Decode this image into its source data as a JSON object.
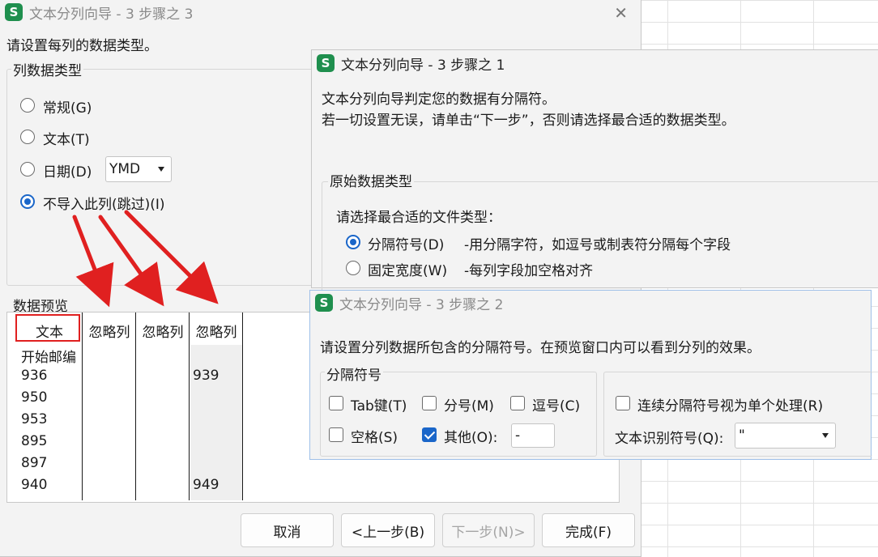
{
  "step3": {
    "title": "文本分列向导 - 3 步骤之 3",
    "instruction": "请设置每列的数据类型。",
    "group_label": "列数据类型",
    "radio_general": "常规(G)",
    "radio_text": "文本(T)",
    "radio_date": "日期(D)",
    "date_format": "YMD",
    "radio_skip": "不导入此列(跳过)(I)",
    "selected_type": "skip",
    "preview_label": "数据预览",
    "preview_headers": [
      "文本",
      "忽略列",
      "忽略列",
      "忽略列"
    ],
    "preview_col1": [
      "开始邮编",
      "936",
      "950",
      "953",
      "895",
      "897",
      "940"
    ],
    "preview_col4": [
      "939",
      "949"
    ],
    "cancel": "取消",
    "back": "<上一步(B)",
    "next": "下一步(N)>",
    "finish": "完成(F)"
  },
  "step1": {
    "title": "文本分列向导 - 3 步骤之 1",
    "line1": "文本分列向导判定您的数据有分隔符。",
    "line2": "若一切设置无误，请单击“下一步”，否则请选择最合适的数据类型。",
    "group_label": "原始数据类型",
    "prompt": "请选择最合适的文件类型：",
    "opt_delimited": "分隔符号(D)",
    "opt_delimited_desc": "-用分隔字符，如逗号或制表符分隔每个字段",
    "opt_fixed": "固定宽度(W)",
    "opt_fixed_desc": "-每列字段加空格对齐",
    "selected": "delimited"
  },
  "step2": {
    "title": "文本分列向导 - 3 步骤之 2",
    "instruction": "请设置分列数据所包含的分隔符号。在预览窗口内可以看到分列的效果。",
    "group_label": "分隔符号",
    "tab": "Tab键(T)",
    "semicolon": "分号(M)",
    "comma": "逗号(C)",
    "space": "空格(S)",
    "other": "其他(O):",
    "other_value": "-",
    "consecutive": "连续分隔符号视为单个处理(R)",
    "qualifier_label": "文本识别符号(Q):",
    "qualifier_value": "\"",
    "checked": [
      "other"
    ]
  },
  "colors": {
    "accent": "#1a66c9",
    "annotation_red": "#e02020",
    "app_icon": "#1f8f4e"
  },
  "icons": [
    "spreadsheet-app-icon",
    "close-icon",
    "dropdown-arrow-icon",
    "annotation-arrow"
  ]
}
